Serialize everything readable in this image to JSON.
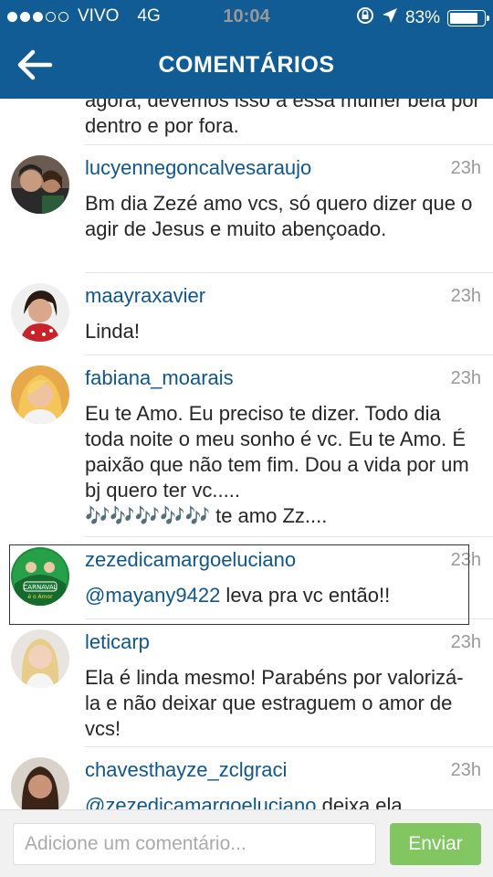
{
  "status_bar": {
    "carrier": "VIVO",
    "network": "4G",
    "time": "10:04",
    "battery": "83%",
    "battery_level": 0.83,
    "signal_bars": 3,
    "signal_total": 5
  },
  "header": {
    "title": "COMENTÁRIOS",
    "back_icon": "arrow-left-icon",
    "bg_color": "#115c94"
  },
  "top_partial_text": "agora, devemos isso a essa mulher bela por dentro e por fora.",
  "comments": [
    {
      "username": "lucyennegoncalvesaraujo",
      "time": "23h",
      "text": "Bm dia Zezé amo vcs, só quero dizer que o agir de Jesus e muito abençoado."
    },
    {
      "username": "maayraxavier",
      "time": "23h",
      "text": "Linda!"
    },
    {
      "username": "fabiana_moarais",
      "time": "23h",
      "text": "Eu te Amo. Eu preciso te dizer. Todo dia toda noite o meu sonho é vc. Eu te Amo. É paixão que não tem fim. Dou a vida por um bj quero ter vc.....",
      "text_line5": "🎶🎶🎶🎶🎶 te amo Zz...."
    },
    {
      "username": "zezedicamargoeluciano",
      "time": "23h",
      "mention": "@mayany9422",
      "text": " leva pra vc então!!"
    },
    {
      "username": "leticarp",
      "time": "23h",
      "text": "Ela é linda mesmo! Parabéns por valorizá-la e não deixar que estraguem o amor de vcs!"
    },
    {
      "username": "chavesthayze_zclgraci",
      "time": "23h",
      "mention": "@zezedicamargoeluciano",
      "text": " deixa ela"
    }
  ],
  "footer": {
    "placeholder": "Adicione um comentário...",
    "send_label": "Enviar",
    "send_color": "#6fbf4a"
  }
}
